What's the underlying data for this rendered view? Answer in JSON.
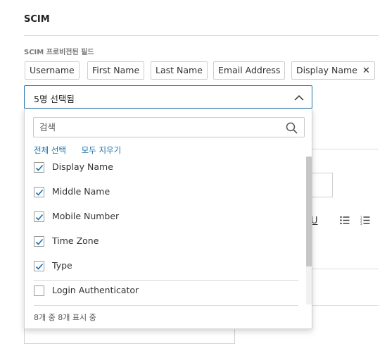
{
  "section": {
    "title": "SCIM"
  },
  "field": {
    "label": "SCIM 프로비전된 필드"
  },
  "tags": [
    {
      "label": "Username"
    },
    {
      "label": "First Name"
    },
    {
      "label": "Last Name"
    },
    {
      "label": "Email Address"
    },
    {
      "label": "Display Name",
      "remove_icon": "close-icon"
    }
  ],
  "select": {
    "value": "5명 선택됨",
    "icon": "chevron-up-icon"
  },
  "dropdown": {
    "search_placeholder": "검색",
    "search_icon": "search-icon",
    "select_all": "전체 선택",
    "clear_all": "모두 지우기",
    "options": [
      {
        "label": "Display Name",
        "checked": true
      },
      {
        "label": "Middle Name",
        "checked": true
      },
      {
        "label": "Mobile Number",
        "checked": true
      },
      {
        "label": "Time Zone",
        "checked": true
      },
      {
        "label": "Type",
        "checked": true
      },
      {
        "label": "Login Authenticator",
        "checked": false
      }
    ],
    "footer": "8개 중 8개 표시 중"
  },
  "toolbar": {
    "underline_label": "U",
    "icons": [
      "bullet-list-icon",
      "numbered-list-icon"
    ]
  },
  "colors": {
    "accent": "#1a6fa8",
    "check": "#1a6fa8",
    "border": "#cfcfcf"
  }
}
